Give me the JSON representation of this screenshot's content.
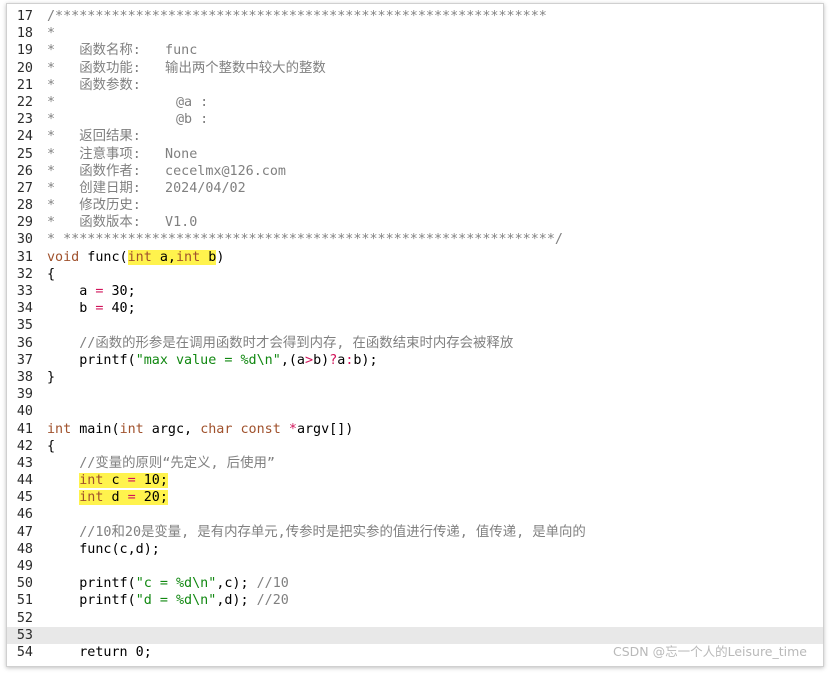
{
  "lines": [
    {
      "n": "17",
      "tokens": [
        {
          "t": "/*************************************************************",
          "c": "comment"
        }
      ]
    },
    {
      "n": "18",
      "tokens": [
        {
          "t": "*",
          "c": "comment"
        }
      ]
    },
    {
      "n": "19",
      "tokens": [
        {
          "t": "*   函数名称:   func",
          "c": "comment"
        }
      ]
    },
    {
      "n": "20",
      "tokens": [
        {
          "t": "*   函数功能:   输出两个整数中较大的整数",
          "c": "comment"
        }
      ]
    },
    {
      "n": "21",
      "tokens": [
        {
          "t": "*   函数参数:",
          "c": "comment"
        }
      ]
    },
    {
      "n": "22",
      "tokens": [
        {
          "t": "*               @a :",
          "c": "comment"
        }
      ]
    },
    {
      "n": "23",
      "tokens": [
        {
          "t": "*               @b :",
          "c": "comment"
        }
      ]
    },
    {
      "n": "24",
      "tokens": [
        {
          "t": "*   返回结果:",
          "c": "comment"
        }
      ]
    },
    {
      "n": "25",
      "tokens": [
        {
          "t": "*   注意事项:   None",
          "c": "comment"
        }
      ]
    },
    {
      "n": "26",
      "tokens": [
        {
          "t": "*   函数作者:   cecelmx@126.com",
          "c": "comment"
        }
      ]
    },
    {
      "n": "27",
      "tokens": [
        {
          "t": "*   创建日期:   2024/04/02",
          "c": "comment"
        }
      ]
    },
    {
      "n": "28",
      "tokens": [
        {
          "t": "*   修改历史:",
          "c": "comment"
        }
      ]
    },
    {
      "n": "29",
      "tokens": [
        {
          "t": "*   函数版本:   V1.0",
          "c": "comment"
        }
      ]
    },
    {
      "n": "30",
      "tokens": [
        {
          "t": "* *************************************************************/",
          "c": "comment"
        }
      ]
    },
    {
      "n": "31",
      "tokens": [
        {
          "t": "void",
          "c": "kw"
        },
        {
          "t": " func(",
          "c": "plain"
        },
        {
          "t": "int",
          "c": "kw",
          "hl": true
        },
        {
          "t": " a,",
          "c": "plain",
          "hl": true
        },
        {
          "t": "int",
          "c": "kw",
          "hl": true
        },
        {
          "t": " b",
          "c": "plain",
          "hl": true
        },
        {
          "t": ")",
          "c": "plain"
        }
      ]
    },
    {
      "n": "32",
      "tokens": [
        {
          "t": "{",
          "c": "plain"
        }
      ]
    },
    {
      "n": "33",
      "tokens": [
        {
          "t": "    a ",
          "c": "plain"
        },
        {
          "t": "=",
          "c": "op"
        },
        {
          "t": " 30;",
          "c": "plain"
        }
      ]
    },
    {
      "n": "34",
      "tokens": [
        {
          "t": "    b ",
          "c": "plain"
        },
        {
          "t": "=",
          "c": "op"
        },
        {
          "t": " 40;",
          "c": "plain"
        }
      ]
    },
    {
      "n": "35",
      "tokens": []
    },
    {
      "n": "36",
      "tokens": [
        {
          "t": "    //函数的形参是在调用函数时才会得到内存, 在函数结束时内存会被释放",
          "c": "comment"
        }
      ]
    },
    {
      "n": "37",
      "tokens": [
        {
          "t": "    printf(",
          "c": "plain"
        },
        {
          "t": "\"max value = %d\\n\"",
          "c": "str"
        },
        {
          "t": ",(a",
          "c": "plain"
        },
        {
          "t": ">",
          "c": "op"
        },
        {
          "t": "b)",
          "c": "plain"
        },
        {
          "t": "?",
          "c": "op"
        },
        {
          "t": "a",
          "c": "plain"
        },
        {
          "t": ":",
          "c": "op"
        },
        {
          "t": "b);",
          "c": "plain"
        }
      ]
    },
    {
      "n": "38",
      "tokens": [
        {
          "t": "}",
          "c": "plain"
        }
      ]
    },
    {
      "n": "39",
      "tokens": []
    },
    {
      "n": "40",
      "tokens": []
    },
    {
      "n": "41",
      "tokens": [
        {
          "t": "int",
          "c": "kw"
        },
        {
          "t": " main(",
          "c": "plain"
        },
        {
          "t": "int",
          "c": "kw"
        },
        {
          "t": " argc, ",
          "c": "plain"
        },
        {
          "t": "char const",
          "c": "kw"
        },
        {
          "t": " ",
          "c": "plain"
        },
        {
          "t": "*",
          "c": "op"
        },
        {
          "t": "argv[])",
          "c": "plain"
        }
      ]
    },
    {
      "n": "42",
      "tokens": [
        {
          "t": "{",
          "c": "plain"
        }
      ]
    },
    {
      "n": "43",
      "tokens": [
        {
          "t": "    //变量的原则“先定义, 后使用”",
          "c": "comment"
        }
      ]
    },
    {
      "n": "44",
      "tokens": [
        {
          "t": "    ",
          "c": "plain"
        },
        {
          "t": "int",
          "c": "kw",
          "hl": true
        },
        {
          "t": " c ",
          "c": "plain",
          "hl": true
        },
        {
          "t": "=",
          "c": "op",
          "hl": true
        },
        {
          "t": " 10;",
          "c": "plain",
          "hl": true
        }
      ]
    },
    {
      "n": "45",
      "tokens": [
        {
          "t": "    ",
          "c": "plain"
        },
        {
          "t": "int",
          "c": "kw",
          "hl": true
        },
        {
          "t": " d ",
          "c": "plain",
          "hl": true
        },
        {
          "t": "=",
          "c": "op",
          "hl": true
        },
        {
          "t": " 20;",
          "c": "plain",
          "hl": true
        }
      ]
    },
    {
      "n": "46",
      "tokens": []
    },
    {
      "n": "47",
      "tokens": [
        {
          "t": "    //10和20是变量, 是有内存单元,传参时是把实参的值进行传递, 值传递, 是单向的",
          "c": "comment"
        }
      ]
    },
    {
      "n": "48",
      "tokens": [
        {
          "t": "    func(c,d);",
          "c": "plain"
        }
      ]
    },
    {
      "n": "49",
      "tokens": []
    },
    {
      "n": "50",
      "tokens": [
        {
          "t": "    printf(",
          "c": "plain"
        },
        {
          "t": "\"c = %d\\n\"",
          "c": "str"
        },
        {
          "t": ",c); ",
          "c": "plain"
        },
        {
          "t": "//10",
          "c": "comment"
        }
      ]
    },
    {
      "n": "51",
      "tokens": [
        {
          "t": "    printf(",
          "c": "plain"
        },
        {
          "t": "\"d = %d\\n\"",
          "c": "str"
        },
        {
          "t": ",d); ",
          "c": "plain"
        },
        {
          "t": "//20",
          "c": "comment"
        }
      ]
    },
    {
      "n": "52",
      "tokens": []
    },
    {
      "n": "53",
      "tokens": [],
      "current": true
    },
    {
      "n": "54",
      "tokens": [
        {
          "t": "    return",
          "c": "plain"
        },
        {
          "t": " 0;",
          "c": "plain"
        }
      ]
    }
  ],
  "watermark": "CSDN @忘一个人的Leisure_time",
  "colors": {
    "comment": "#808080",
    "keyword": "#a0522d",
    "string": "#118811",
    "operator": "#d1145a",
    "highlight": "#fff34d",
    "current_line": "#e8e8e8"
  }
}
